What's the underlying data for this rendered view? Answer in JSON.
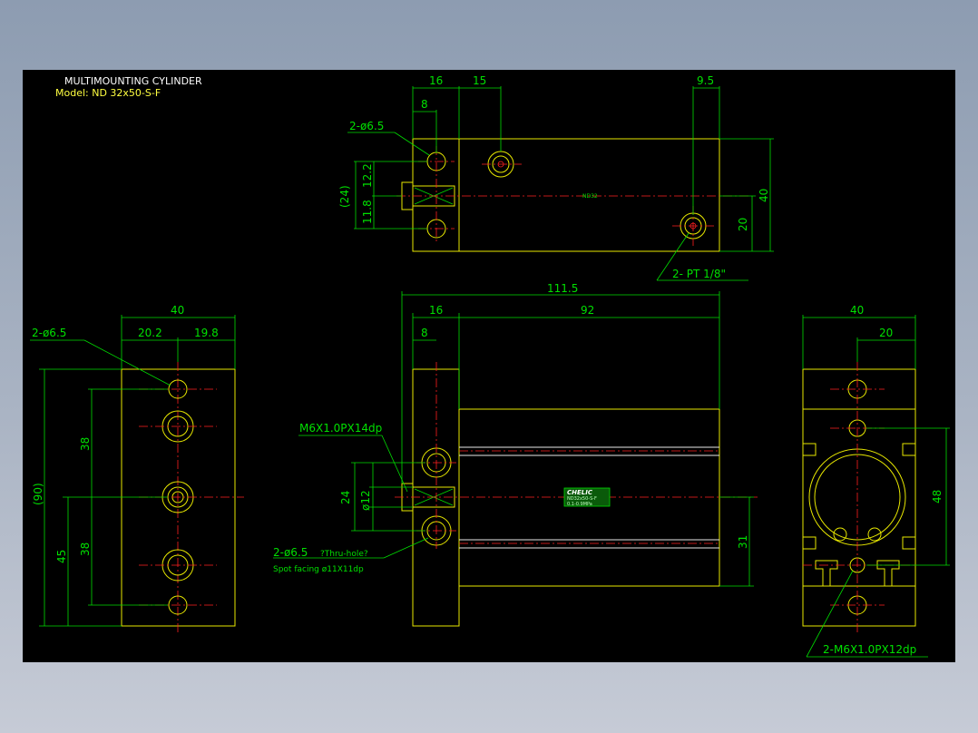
{
  "title": {
    "name": "MULTIMOUNTING CYLINDER",
    "model": "Model: ND 32x50-S-F"
  },
  "top_view": {
    "dim_16": "16",
    "dim_15": "15",
    "dim_8": "8",
    "dim_9_5": "9.5",
    "hole_note": "2-ø6.5",
    "dim_12_2": "12.2",
    "dim_11_8": "11.8",
    "dim_24_ref": "(24)",
    "dim_40": "40",
    "dim_20": "20",
    "port_note": "2- PT 1/8\"",
    "center_mark": "ND32"
  },
  "front_view": {
    "dim_111_5": "111.5",
    "dim_16": "16",
    "dim_92": "92",
    "dim_8": "8",
    "thread_note": "M6X1.0PX14dp",
    "dim_24": "24",
    "dim_dia12": "ø12",
    "hole_note": "2-ø6.5",
    "thru_note": "?Thru-hole?",
    "spot_note": "Spot facing   ø11X11dp",
    "dim_31": "31",
    "label_brand": "CHELIC",
    "label_line2": "ND32x50-S-F",
    "label_line3": "0.1-0.9MPa"
  },
  "left_view": {
    "dim_40": "40",
    "dim_20_2": "20.2",
    "dim_19_8": "19.8",
    "hole_note": "2-ø6.5",
    "dim_38_top": "38",
    "dim_38_bottom": "38",
    "dim_90_ref": "(90)",
    "dim_45": "45"
  },
  "right_view": {
    "dim_40": "40",
    "dim_20": "20",
    "dim_48": "48",
    "thread_note": "2-M6X1.0PX12dp"
  },
  "colors": {
    "background": "#000000",
    "outline": "#e8e800",
    "dimension": "#00dd00",
    "centerline": "#ff2020",
    "title": "#ffffff"
  }
}
